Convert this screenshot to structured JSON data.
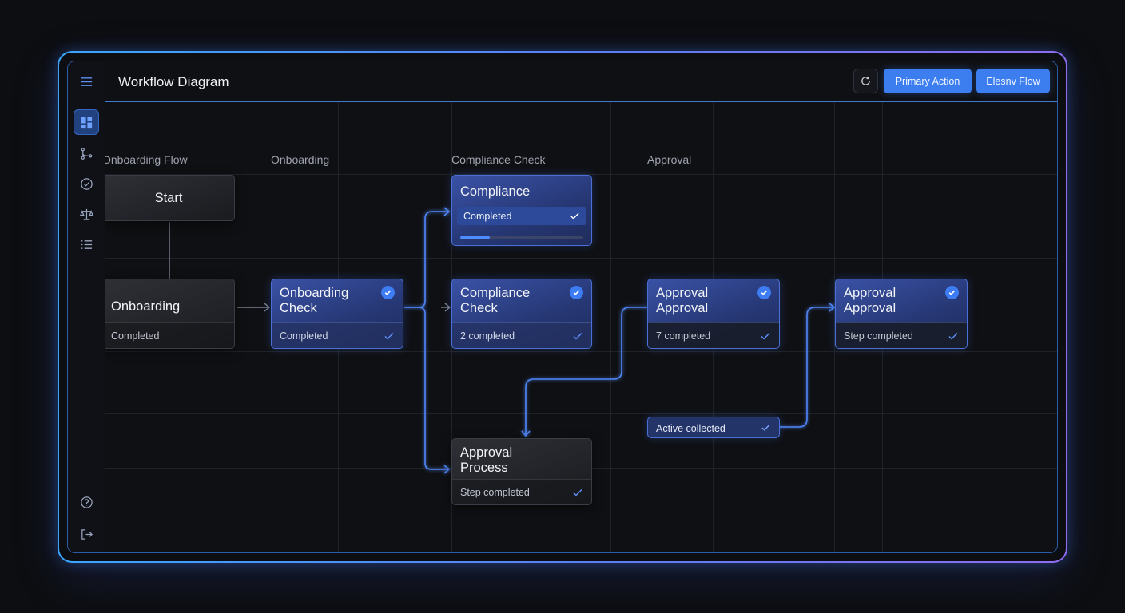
{
  "header": {
    "title": "Workflow Diagram",
    "primary_label": "Primary Action",
    "secondary_label": "Elesnv Flow"
  },
  "sidebar": {
    "top_icons": [
      "menu-icon",
      "dashboard-icon",
      "branch-icon",
      "check-circle-icon",
      "balance-icon",
      "list-icon"
    ],
    "bottom_icons": [
      "help-icon",
      "logout-icon"
    ]
  },
  "columns": [
    "Onboarding Flow",
    "Onboarding",
    "Compliance Check",
    "Approval"
  ],
  "nodes": {
    "start": {
      "label": "Start"
    },
    "onboarding": {
      "title": "Onboarding",
      "status": "Completed"
    },
    "onboarding_check": {
      "title_1": "Onboarding",
      "title_2": "Check",
      "status": "Completed"
    },
    "compliance": {
      "title": "Compliance",
      "status": "Completed",
      "progress": 0.24
    },
    "compliance_check": {
      "title_1": "Compliance",
      "title_2": "Check",
      "status": "2 completed"
    },
    "approval_1": {
      "title_1": "Approval",
      "title_2": "Approval",
      "status": "7 completed"
    },
    "approval_2": {
      "title_1": "Approval",
      "title_2": "Approval",
      "status": "Step completed"
    },
    "approval_process": {
      "title_1": "Approval",
      "title_2": "Process",
      "status": "Step completed"
    },
    "active": {
      "label": "Active collected"
    }
  },
  "colors": {
    "accent": "#3c7df0",
    "border_glow_start": "#3aa6ff",
    "border_glow_end": "#8f6cf0",
    "edge": "#4f86f7"
  }
}
